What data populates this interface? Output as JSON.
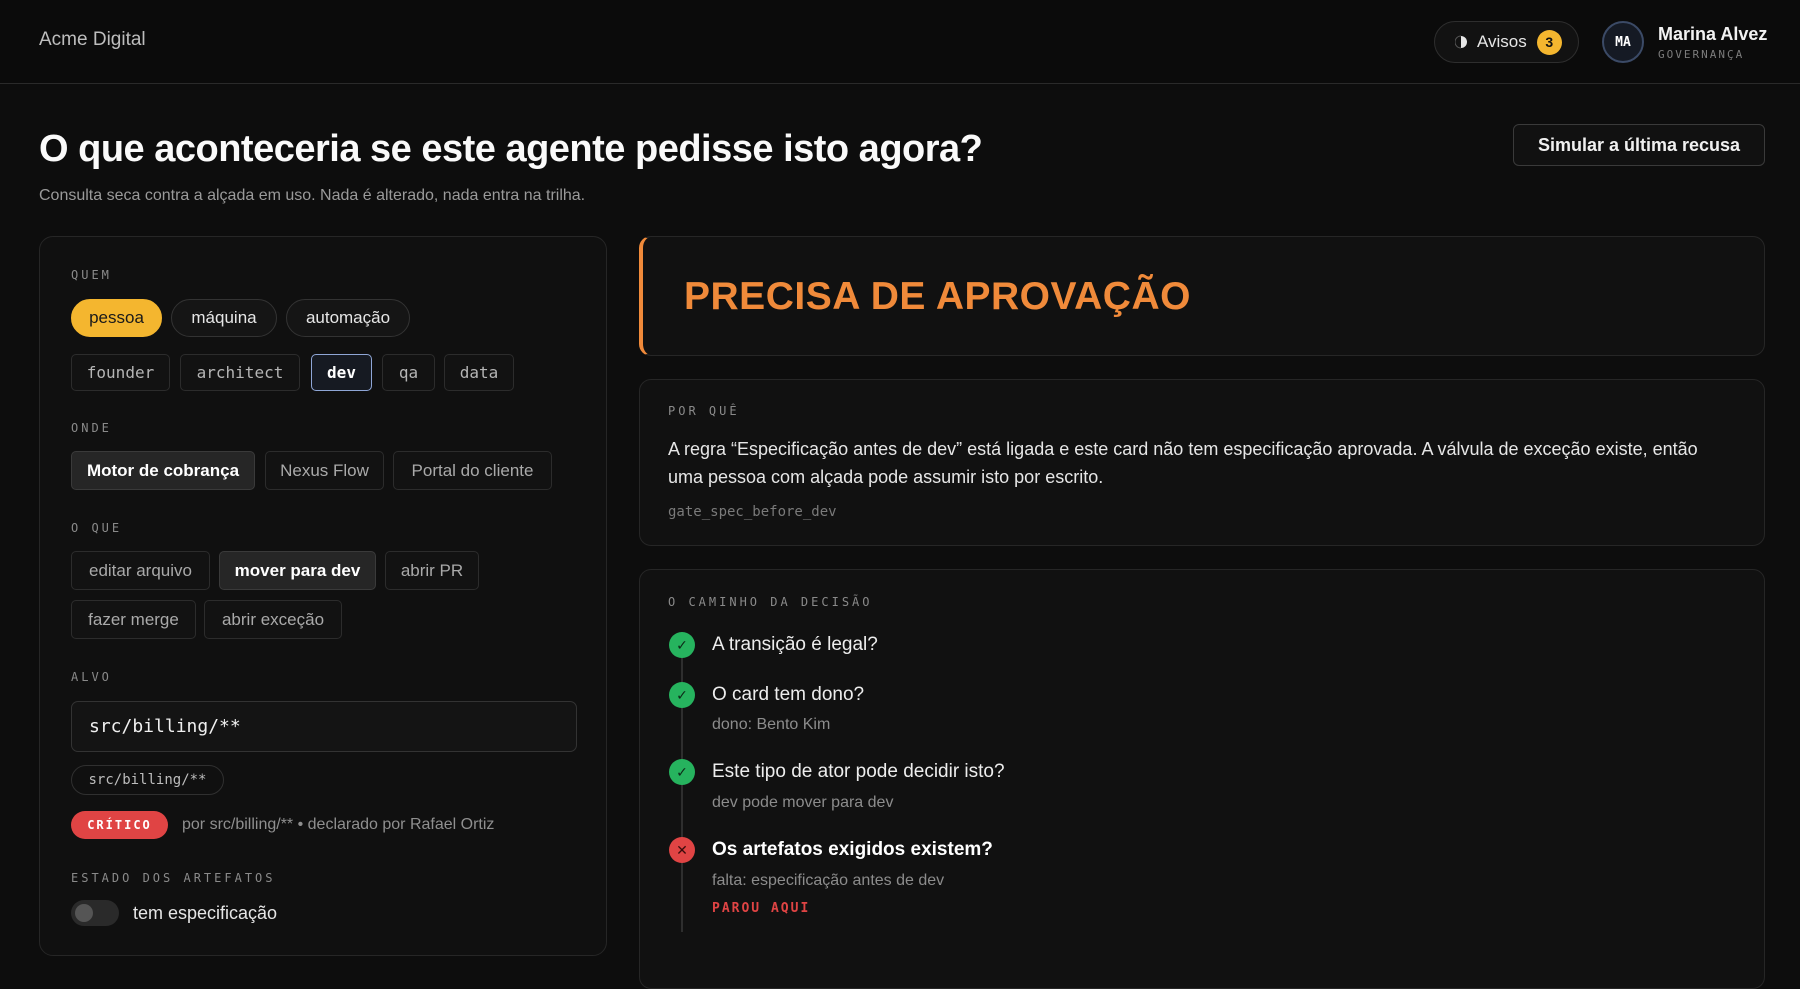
{
  "header": {
    "brand": "Acme Digital",
    "notifications_label": "Avisos",
    "notifications_count": "3",
    "user_initials": "MA",
    "user_name": "Marina Alvez",
    "user_role": "GOVERNANÇA"
  },
  "page": {
    "title": "O que aconteceria se este agente pedisse isto agora?",
    "subtitle": "Consulta seca contra a alçada em uso. Nada é alterado, nada entra na trilha.",
    "simulate_button": "Simular a última recusa"
  },
  "form": {
    "who_label": "QUEM",
    "actor_types": [
      "pessoa",
      "máquina",
      "automação"
    ],
    "actor_type_selected": "pessoa",
    "roles": [
      "founder",
      "architect",
      "dev",
      "qa",
      "data"
    ],
    "role_selected": "dev",
    "where_label": "ONDE",
    "projects": [
      "Motor de cobrança",
      "Nexus Flow",
      "Portal do cliente"
    ],
    "project_selected": "Motor de cobrança",
    "what_label": "O QUE",
    "actions": [
      "editar arquivo",
      "mover para dev",
      "abrir PR",
      "fazer merge",
      "abrir exceção"
    ],
    "action_selected": "mover para dev",
    "target_label": "ALVO",
    "target_value": "src/billing/**",
    "target_suggestion": "src/billing/**",
    "criticality_badge": "CRÍTICO",
    "criticality_note": "por src/billing/** • declarado por Rafael Ortiz",
    "artifacts_label": "ESTADO DOS ARTEFATOS",
    "artifact_toggle_label": "tem especificação",
    "artifact_toggle_on": false
  },
  "result": {
    "verdict": "PRECISA DE APROVAÇÃO",
    "verdict_color": "#f08a3a",
    "why_label": "POR QUÊ",
    "why_text": "A regra “Especificação antes de dev” está ligada e este card não tem especificação aprovada. A válvula de exceção existe, então uma pessoa com alçada pode assumir isto por escrito.",
    "rule_id": "gate_spec_before_dev",
    "path_label": "O CAMINHO DA DECISÃO",
    "steps": [
      {
        "question": "A transição é legal?",
        "detail": "",
        "status": "ok"
      },
      {
        "question": "O card tem dono?",
        "detail": "dono: Bento Kim",
        "status": "ok"
      },
      {
        "question": "Este tipo de ator pode decidir isto?",
        "detail": "dev pode mover para dev",
        "status": "ok"
      },
      {
        "question": "Os artefatos exigidos existem?",
        "detail": "falta: especificação antes de dev",
        "status": "fail",
        "stop_label": "PAROU AQUI"
      }
    ]
  }
}
